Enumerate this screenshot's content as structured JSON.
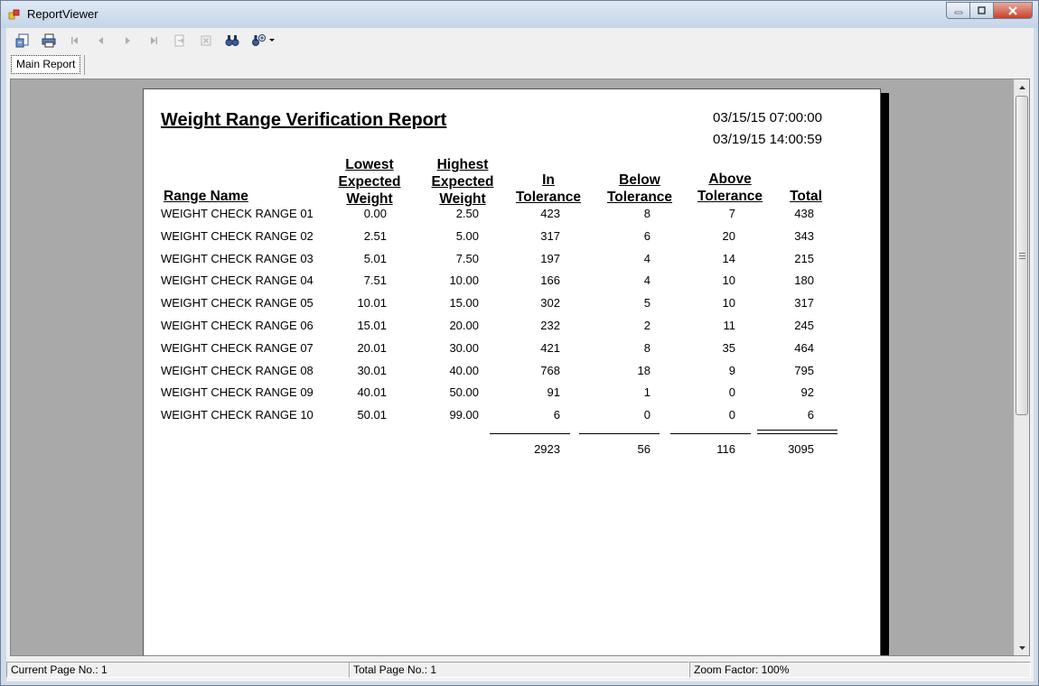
{
  "window": {
    "title": "ReportViewer"
  },
  "tabs": [
    {
      "label": "Main Report"
    }
  ],
  "toolbar": {
    "buttons": [
      {
        "icon": "export-icon",
        "enabled": true
      },
      {
        "icon": "print-icon",
        "enabled": true
      },
      {
        "icon": "first-page-icon",
        "enabled": false
      },
      {
        "icon": "previous-page-icon",
        "enabled": false
      },
      {
        "icon": "next-page-icon",
        "enabled": false
      },
      {
        "icon": "last-page-icon",
        "enabled": false
      },
      {
        "icon": "go-to-page-icon",
        "enabled": false
      },
      {
        "icon": "stop-icon",
        "enabled": false
      },
      {
        "icon": "search-text-icon",
        "enabled": true
      },
      {
        "icon": "zoom-icon",
        "enabled": true
      }
    ]
  },
  "report": {
    "title": "Weight Range Verification Report",
    "start_datetime": "03/15/15 07:00:00",
    "end_datetime": "03/19/15 14:00:59",
    "columns": {
      "range_name": "Range Name",
      "lowest": [
        "Lowest",
        "Expected",
        "Weight"
      ],
      "highest": [
        "Highest",
        "Expected",
        "Weight"
      ],
      "in_tol": [
        "In",
        "Tolerance"
      ],
      "below_tol": [
        "Below",
        "Tolerance"
      ],
      "above_tol": [
        "Above",
        "Tolerance"
      ],
      "total": "Total"
    },
    "rows": [
      {
        "name": "WEIGHT CHECK RANGE 01",
        "lowest": "0.00",
        "highest": "2.50",
        "in": "423",
        "below": "8",
        "above": "7",
        "total": "438"
      },
      {
        "name": "WEIGHT CHECK RANGE 02",
        "lowest": "2.51",
        "highest": "5.00",
        "in": "317",
        "below": "6",
        "above": "20",
        "total": "343"
      },
      {
        "name": "WEIGHT CHECK RANGE 03",
        "lowest": "5.01",
        "highest": "7.50",
        "in": "197",
        "below": "4",
        "above": "14",
        "total": "215"
      },
      {
        "name": "WEIGHT CHECK RANGE 04",
        "lowest": "7.51",
        "highest": "10.00",
        "in": "166",
        "below": "4",
        "above": "10",
        "total": "180"
      },
      {
        "name": "WEIGHT CHECK RANGE 05",
        "lowest": "10.01",
        "highest": "15.00",
        "in": "302",
        "below": "5",
        "above": "10",
        "total": "317"
      },
      {
        "name": "WEIGHT CHECK RANGE 06",
        "lowest": "15.01",
        "highest": "20.00",
        "in": "232",
        "below": "2",
        "above": "11",
        "total": "245"
      },
      {
        "name": "WEIGHT CHECK RANGE 07",
        "lowest": "20.01",
        "highest": "30.00",
        "in": "421",
        "below": "8",
        "above": "35",
        "total": "464"
      },
      {
        "name": "WEIGHT CHECK RANGE 08",
        "lowest": "30.01",
        "highest": "40.00",
        "in": "768",
        "below": "18",
        "above": "9",
        "total": "795"
      },
      {
        "name": "WEIGHT CHECK RANGE 09",
        "lowest": "40.01",
        "highest": "50.00",
        "in": "91",
        "below": "1",
        "above": "0",
        "total": "92"
      },
      {
        "name": "WEIGHT CHECK RANGE 10",
        "lowest": "50.01",
        "highest": "99.00",
        "in": "6",
        "below": "0",
        "above": "0",
        "total": "6"
      }
    ],
    "totals": {
      "in": "2923",
      "below": "56",
      "above": "116",
      "total": "3095"
    }
  },
  "status": {
    "current_page": "Current Page No.: 1",
    "total_page": "Total Page No.: 1",
    "zoom": "Zoom Factor: 100%"
  },
  "colors": {
    "viewer_background": "#a9a9a9",
    "page": "#ffffff",
    "close_button": "#c7422c"
  }
}
